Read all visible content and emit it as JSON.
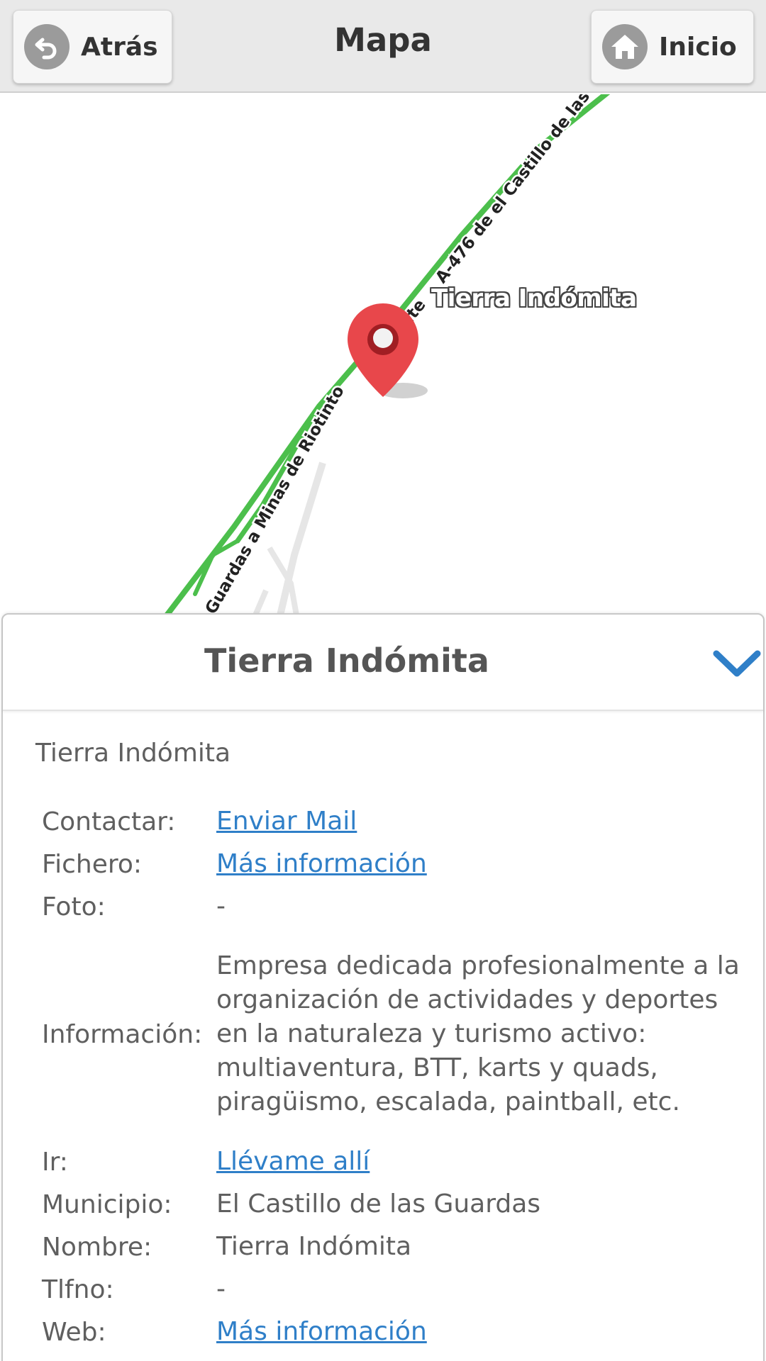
{
  "header": {
    "back_label": "Atrás",
    "title": "Mapa",
    "home_label": "Inicio"
  },
  "map": {
    "place_label": "Tierra Indómita",
    "road_label_1": "A-476 de el Castillo de las",
    "road_label_2": "Guardas a Minas de Riotinto",
    "road_label_3": "ate",
    "route_color": "#4cbf4c",
    "marker_color": "#e8474b"
  },
  "panel": {
    "title": "Tierra Indómita",
    "subtitle": "Tierra Indómita",
    "rows": [
      {
        "key": "Contactar:",
        "value": "Enviar Mail",
        "link": true
      },
      {
        "key": "Fichero:",
        "value": "Más información",
        "link": true
      },
      {
        "key": "Foto:",
        "value": "-",
        "link": false
      },
      {
        "key": "Información:",
        "value": "Empresa dedicada profesionalmente a la organización de actividades y deportes en la naturaleza y turismo activo: multiaventura, BTT, karts y quads, piragüismo, escalada, paintball, etc.",
        "link": false
      },
      {
        "key": "Ir:",
        "value": "Llévame allí",
        "link": true
      },
      {
        "key": "Municipio:",
        "value": "El Castillo de las Guardas",
        "link": false
      },
      {
        "key": "Nombre:",
        "value": "Tierra Indómita",
        "link": false
      },
      {
        "key": "Tlfno:",
        "value": "-",
        "link": false
      },
      {
        "key": "Web:",
        "value": "Más información",
        "link": true
      }
    ]
  },
  "colors": {
    "link": "#2f7fc8",
    "chevron": "#2f7fc8",
    "header_bg": "#e9e9e9"
  },
  "icons": {
    "back": "undo-arrow-icon",
    "home": "home-icon",
    "collapse": "chevron-down-icon",
    "marker": "map-pin-icon"
  }
}
